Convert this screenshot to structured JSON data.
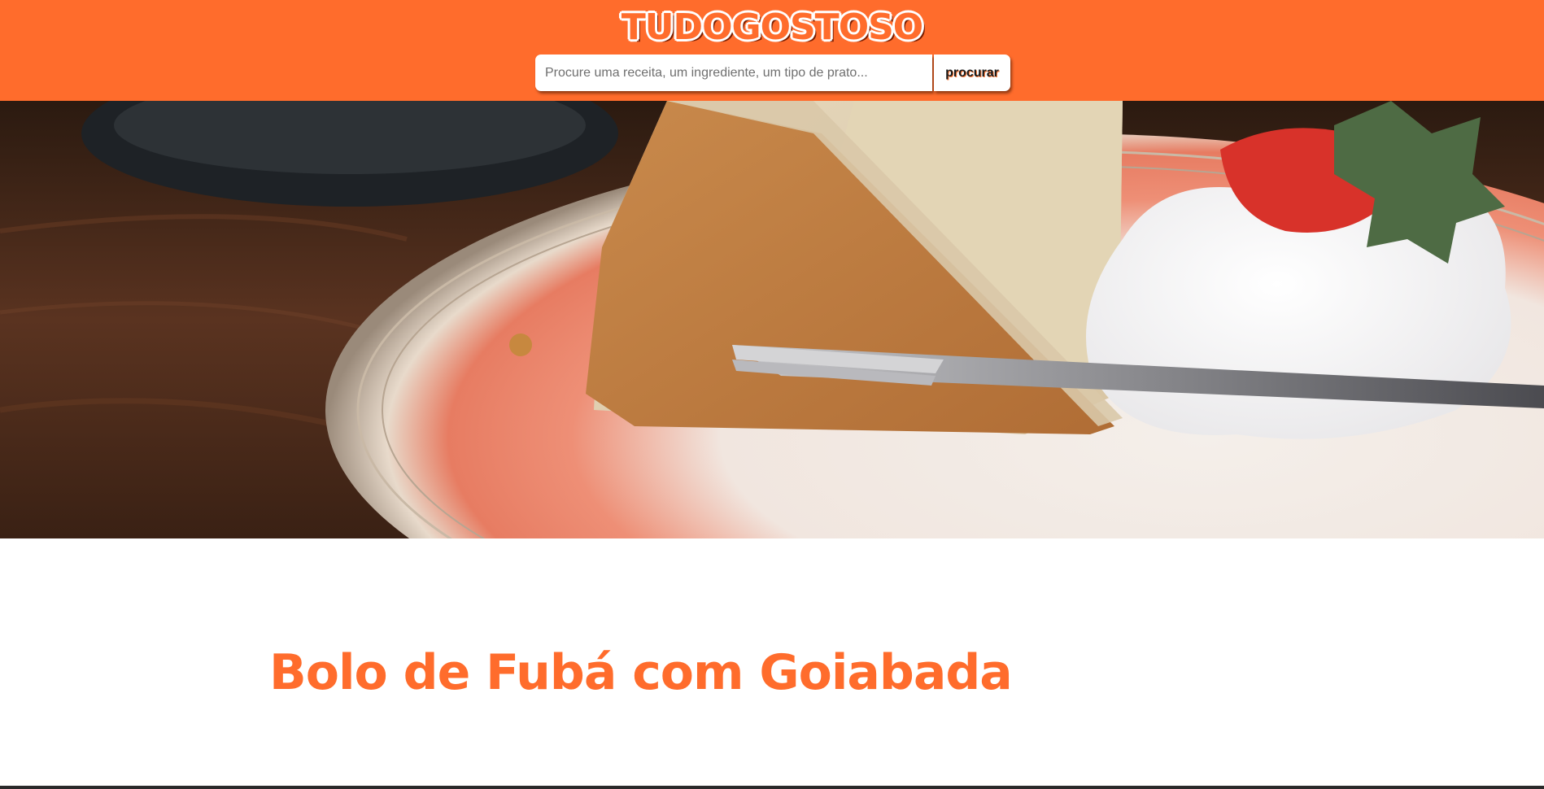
{
  "header": {
    "logo_text": "TUDOGOSTOSO",
    "background_color": "#ff6c2c"
  },
  "search": {
    "placeholder": "Procure uma receita, um ingrediente, um tipo de prato...",
    "value": "",
    "button_label": "procurar"
  },
  "hero": {
    "image_subject": "slice of cake on a decorated plate with whipped cream and a strawberry, fork in front"
  },
  "recipe": {
    "title": "Bolo de Fubá com Goiabada",
    "title_color": "#ff6c2c"
  }
}
